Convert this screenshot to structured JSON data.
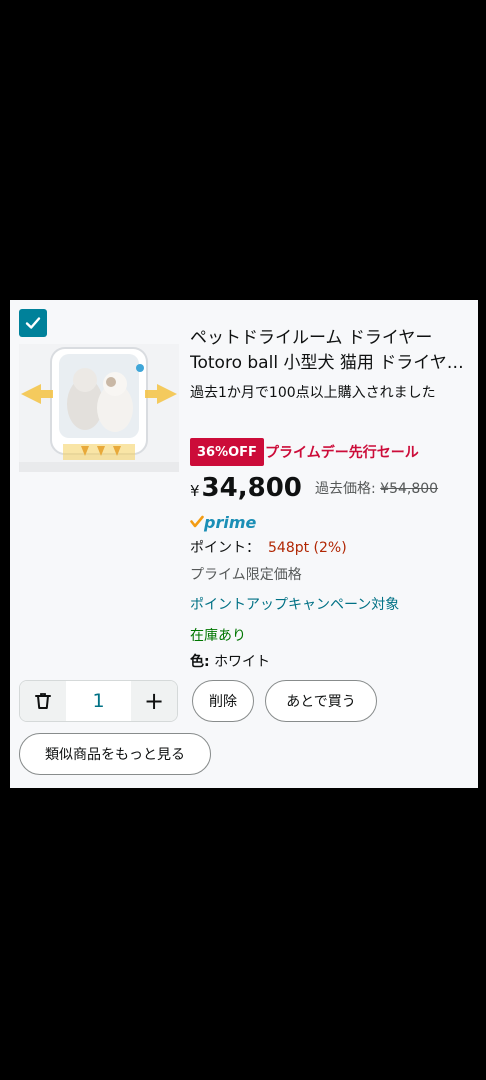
{
  "item": {
    "title": "ペットドライルーム ドライヤー Totoro ball 小型犬 猫用 ドライヤーハウス",
    "bought_text": "過去1か月で100点以上購入されました",
    "badge": "36%OFF",
    "deal_label": "プライムデー先行セール",
    "price_currency": "¥",
    "price": "34,800",
    "list_price_label": "過去価格:",
    "list_price": "¥54,800",
    "prime_label": "prime",
    "points_label": "ポイント：",
    "points_value": "548pt (2%)",
    "limited_label": "プライム限定価格",
    "campaign_link": "ポイントアップキャンペーン対象",
    "stock": "在庫あり",
    "color_label": "色:",
    "color_value": "ホワイト",
    "checked": true
  },
  "actions": {
    "quantity": "1",
    "plus_label": "+",
    "delete_label": "削除",
    "save_later_label": "あとで買う",
    "similar_label": "類似商品をもっと見る"
  },
  "colors": {
    "accent": "#00819a",
    "deal": "#cc0c39",
    "link": "#007185",
    "stock": "#007600",
    "price_red": "#b12704",
    "prime_check": "#f39c12",
    "prime_text": "#1b8fb6"
  },
  "icons": {
    "checkbox": "checkmark-icon",
    "trash": "trash-icon",
    "prime": "prime-check-icon"
  }
}
